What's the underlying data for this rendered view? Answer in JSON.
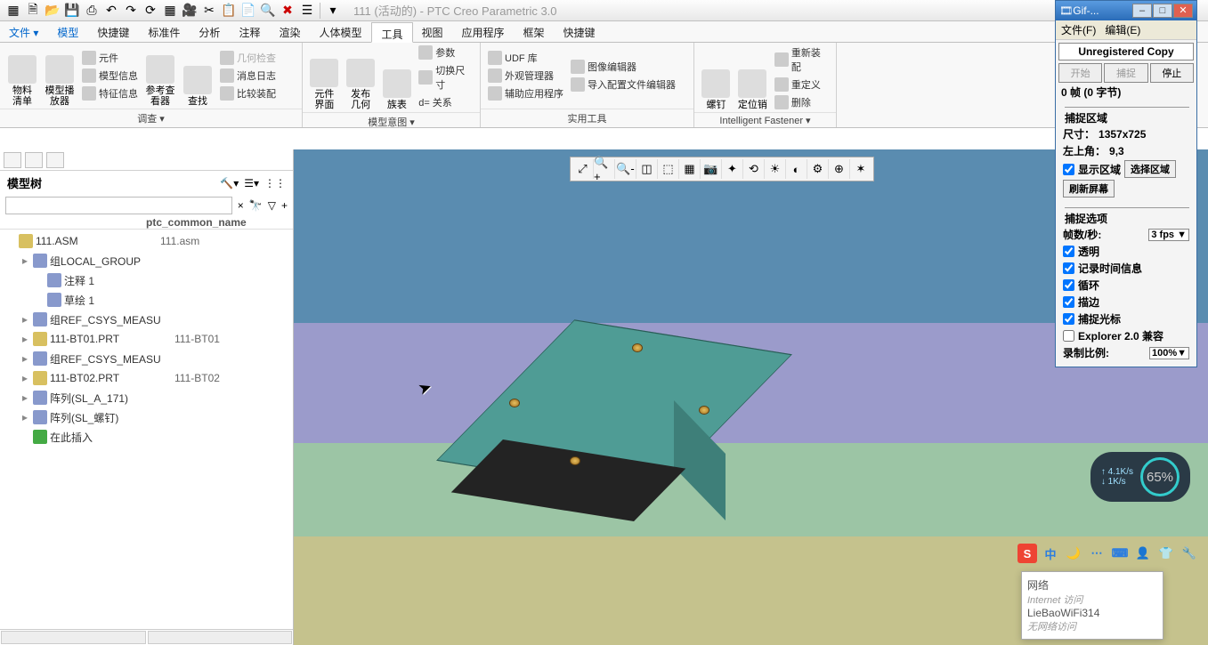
{
  "qat_icons": [
    "new",
    "open",
    "save",
    "save-as",
    "undo",
    "redo",
    "regen",
    "win",
    "copy",
    "paste",
    "cut",
    "note",
    "find",
    "x",
    "layers",
    "▾"
  ],
  "app_title": "111 (活动的) - PTC Creo Parametric 3.0",
  "file_menu": "文件",
  "tabs": [
    "模型",
    "快捷键",
    "标准件",
    "分析",
    "注释",
    "渲染",
    "人体模型",
    "工具",
    "视图",
    "应用程序",
    "框架",
    "快捷键"
  ],
  "active_tab_index": 7,
  "ribbon": {
    "group1": {
      "label": "调查 ▾",
      "items": {
        "big1": "物料\n清单",
        "big2": "模型播\n放器",
        "s1": "元件",
        "s2": "模型信息",
        "s3": "特征信息",
        "big3": "参考查\n看器",
        "big4": "查找"
      }
    },
    "group2": {
      "label": "模型意图 ▾",
      "items": {
        "s1": "几何检查",
        "s2": "消息日志",
        "s3": "比较装配",
        "big1": "元件\n界面",
        "big2": "发布\n几何",
        "big3": "族表",
        "s4": "参数",
        "s5": "切换尺寸",
        "s6": "d= 关系"
      }
    },
    "group3": {
      "label": "实用工具",
      "items": {
        "s1": "UDF 库",
        "s2": "外观管理器",
        "s3": "辅助应用程序",
        "s4": "图像编辑器",
        "s5": "导入配置文件编辑器"
      }
    },
    "group4": {
      "label": "Intelligent Fastener ▾",
      "items": {
        "big1": "螺钉",
        "big2": "定位销",
        "s1": "重新装配",
        "s2": "重定义",
        "s3": "删除"
      }
    }
  },
  "left_panel": {
    "title": "模型树",
    "col2_header": "ptc_common_name",
    "tree": [
      {
        "indent": 0,
        "name": "111.ASM",
        "col2": "111.asm",
        "tw": "",
        "ic": "ylw"
      },
      {
        "indent": 1,
        "name": "组LOCAL_GROUP",
        "col2": "",
        "tw": "▸",
        "ic": ""
      },
      {
        "indent": 2,
        "name": "注释 1",
        "col2": "",
        "tw": "",
        "ic": ""
      },
      {
        "indent": 2,
        "name": "草绘 1",
        "col2": "",
        "tw": "",
        "ic": ""
      },
      {
        "indent": 1,
        "name": "组REF_CSYS_MEASU",
        "col2": "",
        "tw": "▸",
        "ic": ""
      },
      {
        "indent": 1,
        "name": "111-BT01.PRT",
        "col2": "111-BT01",
        "tw": "▸",
        "ic": "ylw"
      },
      {
        "indent": 1,
        "name": "组REF_CSYS_MEASU",
        "col2": "",
        "tw": "▸",
        "ic": ""
      },
      {
        "indent": 1,
        "name": "111-BT02.PRT",
        "col2": "111-BT02",
        "tw": "▸",
        "ic": "ylw"
      },
      {
        "indent": 1,
        "name": "阵列(SL_A_171)",
        "col2": "",
        "tw": "▸",
        "ic": ""
      },
      {
        "indent": 1,
        "name": "阵列(SL_螺钉)",
        "col2": "",
        "tw": "▸",
        "ic": ""
      },
      {
        "indent": 1,
        "name": "在此插入",
        "col2": "",
        "tw": "",
        "ic": "grn"
      }
    ]
  },
  "view_toolbar_count": 14,
  "gif": {
    "title": "Gif-...",
    "menu_file": "文件(F)",
    "menu_edit": "编辑(E)",
    "banner": "Unregistered Copy",
    "btn_start": "开始",
    "btn_capture": "捕捉",
    "btn_stop": "停止",
    "status": "0 帧 (0 字节)",
    "grp_area": "捕捉区域",
    "size_lab": "尺寸：",
    "size_val": "1357x725",
    "tl_lab": "左上角：",
    "tl_val": "9,3",
    "show_area": "显示区域",
    "select_area": "选择区域",
    "refresh": "刷新屏幕",
    "grp_opts": "捕捉选项",
    "fps_lab": "帧数/秒:",
    "fps_val": "3 fps ▼",
    "opt_trans": "透明",
    "opt_time": "记录时间信息",
    "opt_loop": "循环",
    "opt_stroke": "描边",
    "opt_cursor": "捕捉光标",
    "opt_ie": "Explorer 2.0 兼容",
    "ratio_lab": "录制比例:",
    "ratio_val": "100%▼"
  },
  "net_meter": {
    "up": "↑ 4.1K/s",
    "down": "↓ 1K/s",
    "pct": "65%"
  },
  "ime_icons": [
    "S",
    "中",
    "🌙",
    "⋯",
    "⌨",
    "👤",
    "👕",
    "🔧"
  ],
  "net_popup": {
    "l1": "网络",
    "l2": "Internet 访问",
    "l3": "LieBaoWiFi314",
    "l4": "无网络访问"
  }
}
